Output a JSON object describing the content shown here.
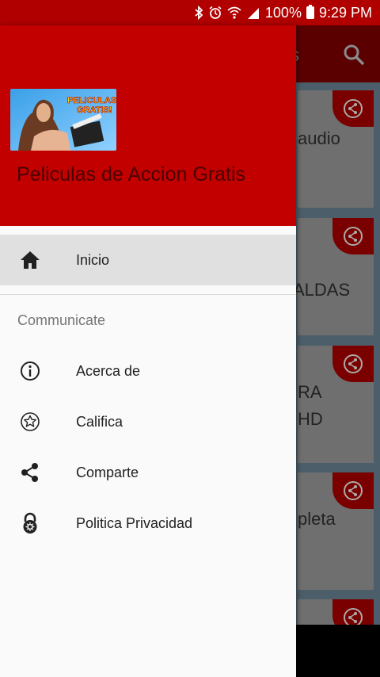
{
  "status_bar": {
    "battery": "100%",
    "time": "9:29 PM",
    "icons": [
      "bluetooth-icon",
      "alarm-icon",
      "wifi-icon",
      "signal-icon",
      "battery-icon"
    ]
  },
  "background": {
    "toolbar_title_fragment": "s",
    "cards": [
      {
        "lines": [
          "audio"
        ]
      },
      {
        "lines": [
          "ALDAS"
        ]
      },
      {
        "lines": [
          "RA",
          " HD"
        ]
      },
      {
        "lines": [
          "pleta"
        ]
      }
    ]
  },
  "drawer": {
    "app_name": "Peliculas de Accion Gratis",
    "logo_text_line1": "PELICULAS",
    "logo_text_line2": "GRATIS!",
    "primary_items": [
      {
        "label": "Inicio",
        "icon": "home-icon",
        "active": true
      }
    ],
    "section_header": "Communicate",
    "items": [
      {
        "label": "Acerca de",
        "icon": "info-icon"
      },
      {
        "label": "Califica",
        "icon": "star-icon"
      },
      {
        "label": "Comparte",
        "icon": "share-icon"
      },
      {
        "label": "Politica Privacidad",
        "icon": "lock-icon"
      }
    ]
  },
  "colors": {
    "primary": "#c20000",
    "status_bar": "#b00000",
    "drawer_bg": "#fafafa",
    "active_item_bg": "#e0e0e0"
  }
}
